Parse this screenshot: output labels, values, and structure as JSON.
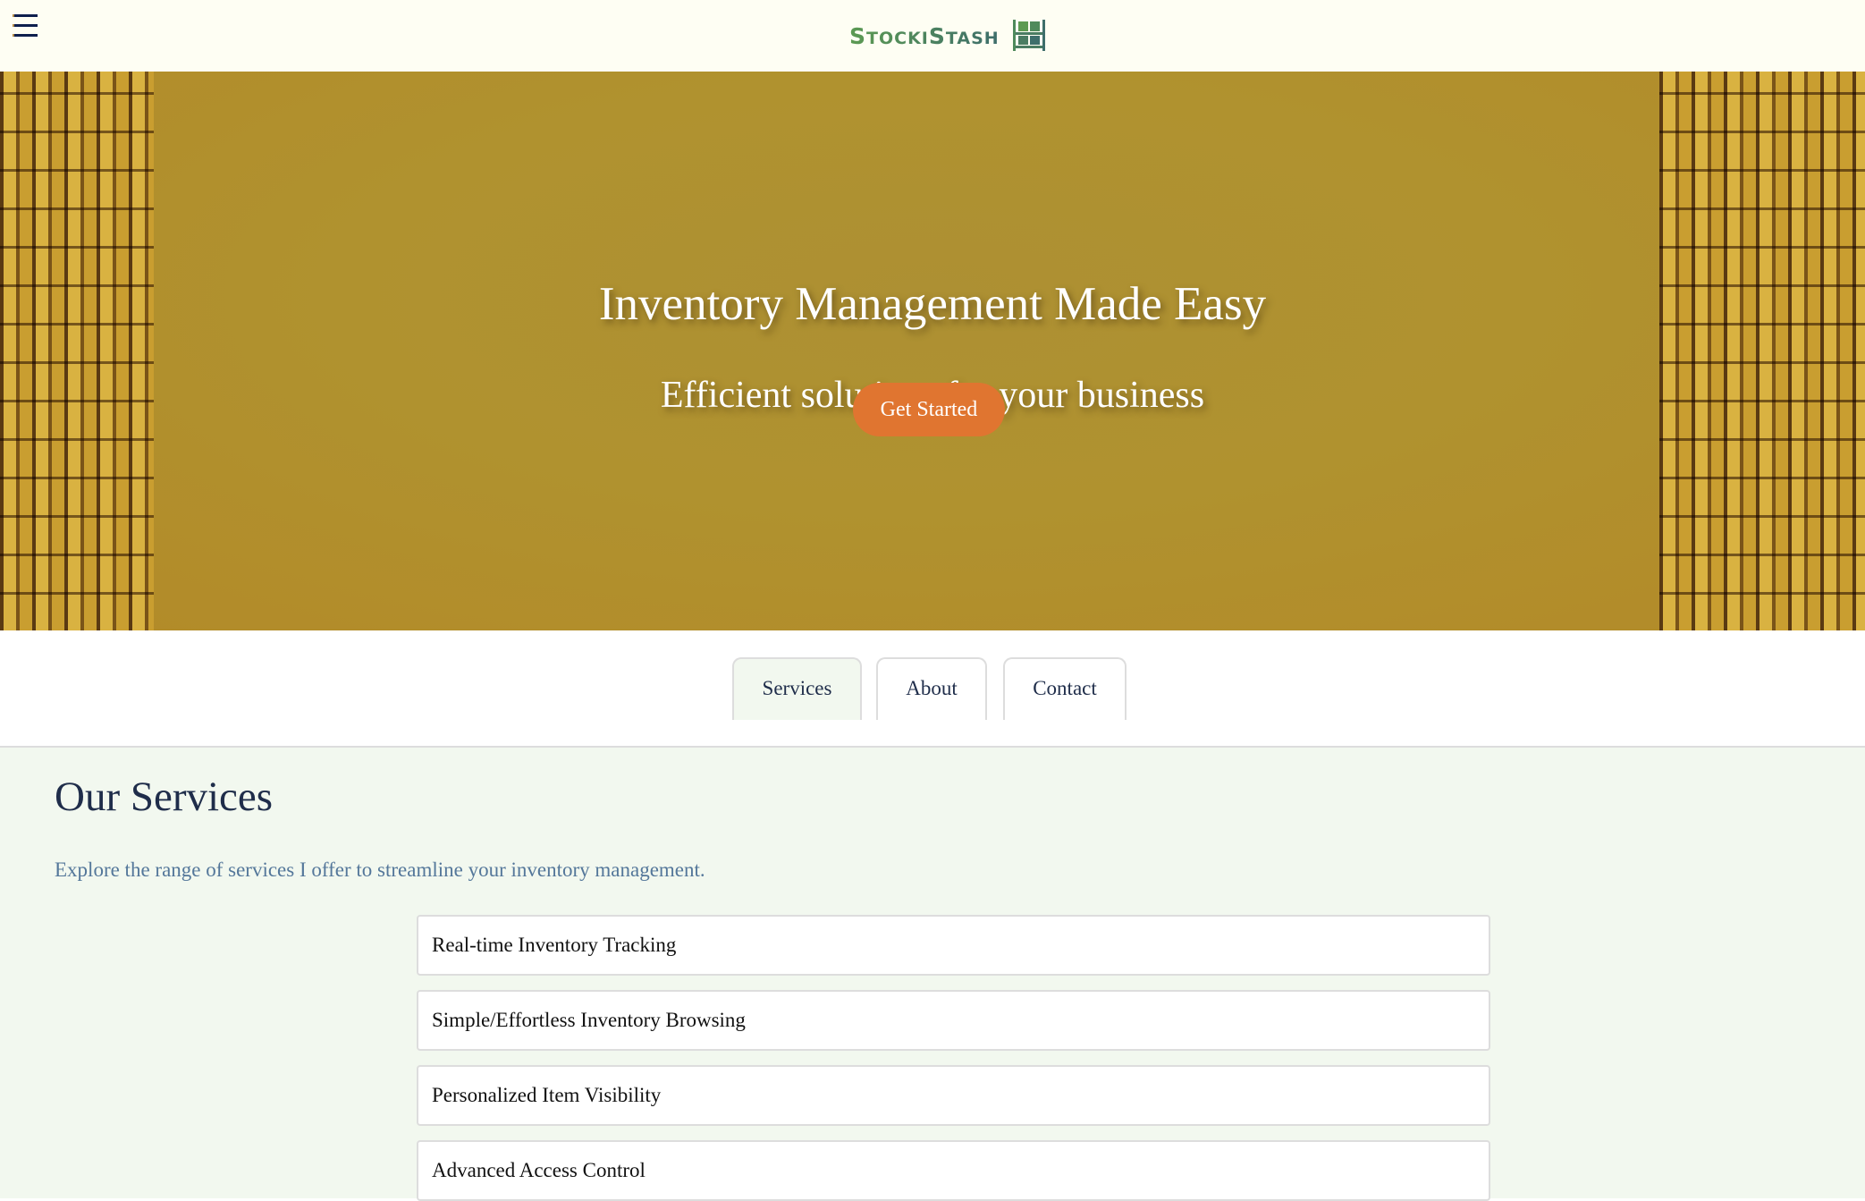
{
  "header": {
    "logo_text": "StockiStash",
    "menu_icon": "hamburger-icon",
    "logo_icon": "shelf-boxes-icon"
  },
  "hero": {
    "title": "Inventory Management Made Easy",
    "subtitle": "Efficient solutions for your business",
    "cta_label": "Get Started"
  },
  "tabs": [
    {
      "label": "Services",
      "active": true
    },
    {
      "label": "About",
      "active": false
    },
    {
      "label": "Contact",
      "active": false
    }
  ],
  "services": {
    "title": "Our Services",
    "description": "Explore the range of services I offer to streamline your inventory management.",
    "items": [
      "Real-time Inventory Tracking",
      "Simple/Effortless Inventory Browsing",
      "Personalized Item Visibility",
      "Advanced Access Control"
    ]
  },
  "colors": {
    "accent": "#e07530",
    "hero_gold": "#b0922f",
    "text_dark": "#1f2d4a",
    "section_bg": "#f2f8ef"
  }
}
